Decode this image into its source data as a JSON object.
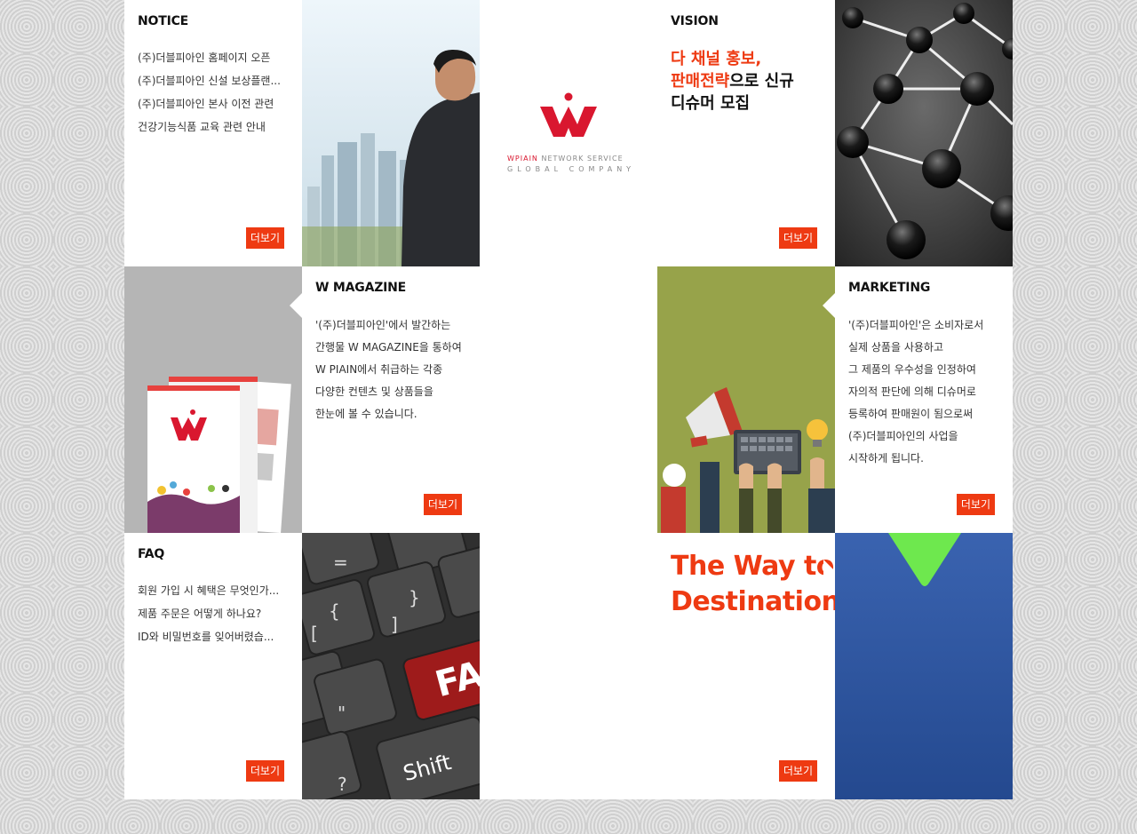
{
  "notice": {
    "title": "NOTICE",
    "items": [
      "(주)더블피아인 홈페이지 오픈",
      "(주)더블피아인 신설 보상플랜...",
      "(주)더블피아인 본사 이전 관련",
      "건강기능식품 교육 관련 안내"
    ],
    "more": "더보기"
  },
  "logo": {
    "brand": "WPIAIN",
    "service": " NETWORK SERVICE",
    "subtitle": "GLOBAL COMPANY",
    "brand_color": "#d9172f"
  },
  "vision": {
    "title": "VISION",
    "line1": "다 채널 홍보,",
    "line2_red": "판매전략",
    "line2_rest": "으로 신규",
    "line3": "디슈머 모집",
    "more": "더보기"
  },
  "magazine": {
    "title": "W MAGAZINE",
    "lines": [
      "'(주)더블피아인'에서 발간하는",
      "간행물 W MAGAZINE을 통하여",
      "W PIAIN에서 취급하는 각종",
      "다양한 컨텐츠 및 상품들을",
      "한눈에 볼 수 있습니다."
    ],
    "more": "더보기"
  },
  "marketing": {
    "title": "MARKETING",
    "lines": [
      "'(주)더블피아인'은 소비자로서",
      "실제 상품을 사용하고",
      "그 제품의 우수성을 인정하여",
      "자의적 판단에 의해 디슈머로",
      "등록하여 판매원이 됨으로써",
      "(주)더블피아인의 사업을",
      "시작하게 됩니다."
    ],
    "more": "더보기"
  },
  "faq": {
    "title": "FAQ",
    "items": [
      "회원 가입 시 혜택은 무엇인가...",
      "제품 주문은 어떻게 하나요?",
      "ID와 비밀번호를 잊어버렸습..."
    ],
    "more": "더보기"
  },
  "keyboard": {
    "key_text": "FA",
    "shift": "Shift"
  },
  "way": {
    "line1": "The Way to",
    "line2": "Destination",
    "more": "더보기"
  },
  "colors": {
    "accent": "#ee3a12",
    "marketing_bg": "#97a34a",
    "magazine_bg": "#b5b5b5",
    "blue_panel": "#2f57a4",
    "green_arrow": "#6ee84e"
  }
}
